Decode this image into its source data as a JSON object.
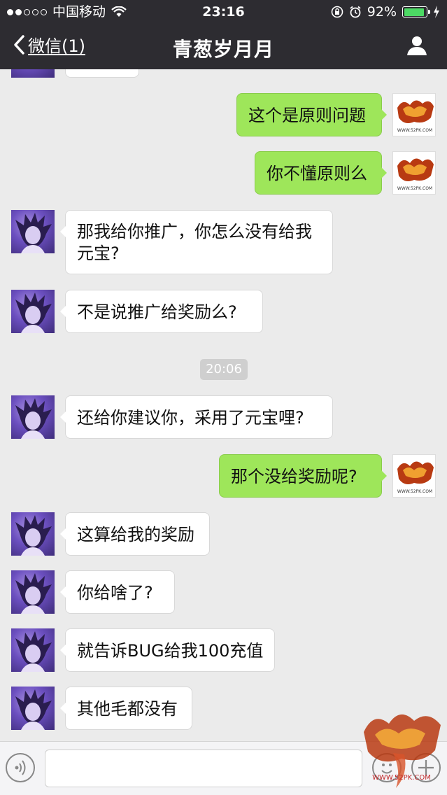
{
  "status_bar": {
    "carrier": "中国移动",
    "time": "23:16",
    "battery": "92%",
    "battery_level": 0.92
  },
  "nav": {
    "back_label": "微信(1)",
    "title": "青葱岁月月"
  },
  "messages": [
    {
      "side": "them",
      "text": ""
    },
    {
      "side": "me",
      "text": "这个是原则问题"
    },
    {
      "side": "me",
      "text": "你不懂原则么"
    },
    {
      "side": "them",
      "text": "那我给你推广，你怎么没有给我元宝?"
    },
    {
      "side": "them",
      "text": "不是说推广给奖励么?"
    },
    {
      "side": "them",
      "text": "还给你建议你，采用了元宝哩?"
    },
    {
      "side": "me",
      "text": "那个没给奖励呢?"
    },
    {
      "side": "them",
      "text": "这算给我的奖励"
    },
    {
      "side": "them",
      "text": "你给啥了?"
    },
    {
      "side": "them",
      "text": "就告诉BUG给我100充值"
    },
    {
      "side": "them",
      "text": "其他毛都没有"
    }
  ],
  "timestamp": "20:06",
  "input": {
    "placeholder": "",
    "value": ""
  },
  "avatar_label": "WWW.52PK.COM",
  "colors": {
    "nav_bg": "#2d2c31",
    "chat_bg": "#ebebeb",
    "me_bubble": "#9ee65a",
    "them_bubble": "#ffffff",
    "battery": "#4cd964"
  },
  "icons": [
    "chevron-left-icon",
    "person-icon",
    "wifi-icon",
    "lock-rotation-icon",
    "alarm-icon",
    "charging-icon",
    "voice-icon",
    "emoji-icon",
    "plus-icon"
  ]
}
